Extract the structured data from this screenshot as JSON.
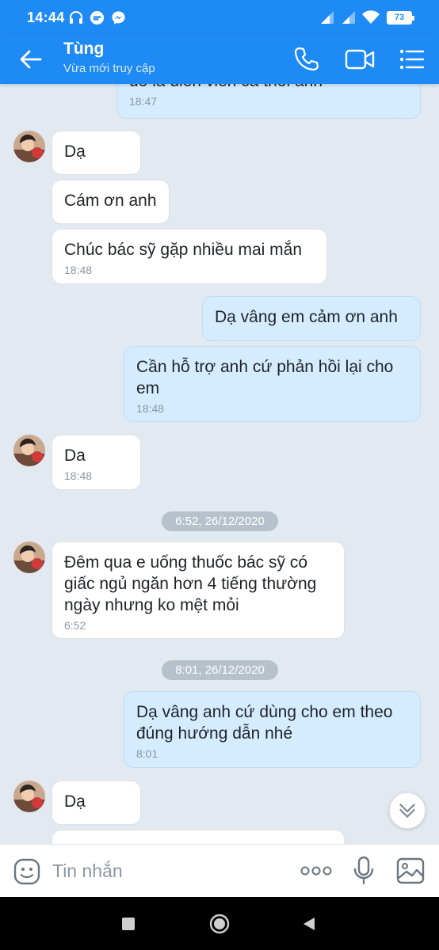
{
  "status_bar": {
    "time": "14:44",
    "battery": "73",
    "icons": [
      "headphones-icon",
      "messenger-icon",
      "signal-icon",
      "wifi-icon",
      "battery-icon"
    ]
  },
  "header": {
    "contact_name": "Tùng",
    "contact_status": "Vừa mới truy cập",
    "buttons": [
      "back-arrow-icon",
      "phone-icon",
      "video-call-icon",
      "menu-icon"
    ]
  },
  "messages": [
    {
      "direction": "out",
      "text": "đó là diễn viên cả thôi anh",
      "time": "18:47"
    },
    {
      "direction": "in",
      "text": "Dạ",
      "time": ""
    },
    {
      "direction": "in",
      "text": "Cám ơn anh",
      "time": ""
    },
    {
      "direction": "in",
      "text": "Chúc bác sỹ gặp nhiều mai mắn",
      "time": "18:48"
    },
    {
      "direction": "out",
      "text": "Dạ vâng em cảm ơn anh",
      "time": ""
    },
    {
      "direction": "out",
      "text": "Cần hỗ trợ anh cứ phản hồi lại cho em",
      "time": "18:48"
    },
    {
      "direction": "in",
      "text": "Da",
      "time": "18:48"
    },
    {
      "direction": "in",
      "text": "Đêm qua e uống thuốc bác sỹ có giấc ngủ ngăn hơn 4 tiếng thường ngày nhưng ko mệt mỏi",
      "time": "6:52"
    },
    {
      "direction": "out",
      "text": "Dạ vâng anh cứ dùng cho em theo đúng hướng dẫn nhé",
      "time": "8:01"
    },
    {
      "direction": "in",
      "text": "Dạ",
      "time": ""
    }
  ],
  "date_separators": [
    "6:52, 26/12/2020",
    "8:01, 26/12/2020"
  ],
  "input": {
    "placeholder": "Tin nhắn",
    "buttons": [
      "sticker-icon",
      "more-icon",
      "microphone-icon",
      "image-icon"
    ]
  },
  "nav_bar": {
    "buttons": [
      "recents-icon",
      "home-icon",
      "back-icon"
    ]
  },
  "colors": {
    "header_blue": "#1e8af5",
    "outgoing_bubble": "#d5ecff",
    "incoming_bubble": "#ffffff",
    "chat_background": "#e2e9f1"
  }
}
